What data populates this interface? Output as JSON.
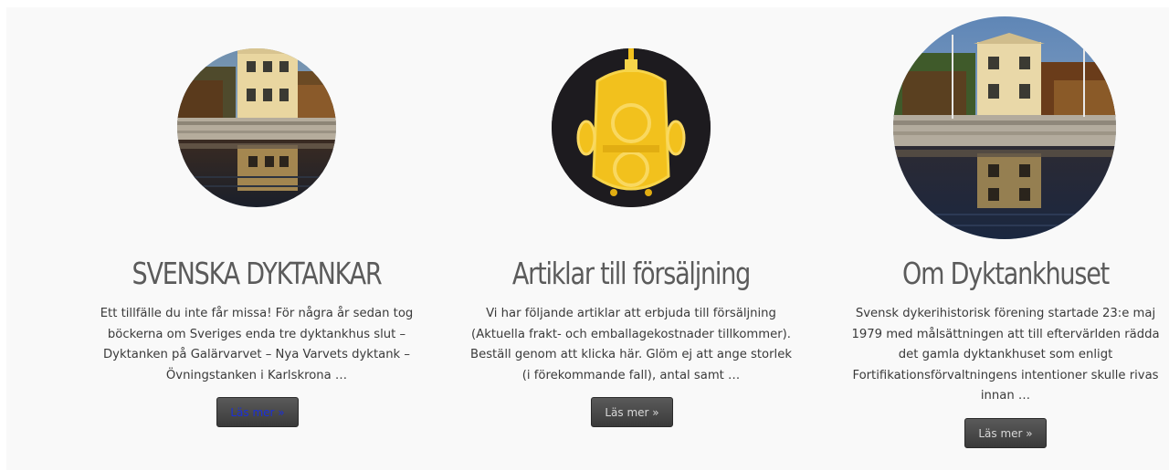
{
  "features": [
    {
      "title": "SVENSKA DYKTANKAR",
      "excerpt": "Ett tillfälle du inte får missa!  För några år sedan tog böckerna om Sveriges enda tre dyktankhus slut – Dyktanken på Galärvarvet – Nya Varvets dyktank – Övningstanken i Karlskrona …",
      "button_label": "Läs mer »"
    },
    {
      "title": "Artiklar till försäljning",
      "excerpt": "Vi har följande artiklar att erbjuda till försäljning (Aktuella frakt- och emballagekostnader tillkommer). Beställ genom att klicka här. Glöm ej att ange storlek (i förekommande fall), antal samt …",
      "button_label": "Läs mer »"
    },
    {
      "title": "Om Dyktankhuset",
      "excerpt": "Svensk dykerihistorisk förening startade 23:e maj 1979 med målsättningen att till eftervärlden rädda det gamla dyktankhuset som enligt Fortifikationsförvaltningens intentioner skulle rivas innan …",
      "button_label": "Läs mer »"
    }
  ]
}
